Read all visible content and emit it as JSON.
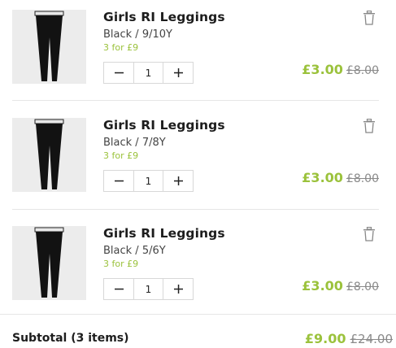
{
  "cart": {
    "items": [
      {
        "name": "Girls RI Leggings",
        "variant": "Black / 9/10Y",
        "promo": "3 for £9",
        "quantity": "1",
        "price_now": "£3.00",
        "price_was": "£8.00",
        "image_icon": "leggings-image"
      },
      {
        "name": "Girls RI Leggings",
        "variant": "Black / 7/8Y",
        "promo": "3 for £9",
        "quantity": "1",
        "price_now": "£3.00",
        "price_was": "£8.00",
        "image_icon": "leggings-image"
      },
      {
        "name": "Girls RI Leggings",
        "variant": "Black / 5/6Y",
        "promo": "3 for £9",
        "quantity": "1",
        "price_now": "£3.00",
        "price_was": "£8.00",
        "image_icon": "leggings-image"
      }
    ],
    "subtotal": {
      "label": "Subtotal (3 items)",
      "price_now": "£9.00",
      "price_was": "£24.00"
    }
  },
  "icons": {
    "decrease": "minus-icon",
    "increase": "plus-icon",
    "remove": "trash-icon"
  },
  "colors": {
    "sale_price": "#9bc23c",
    "promo": "#9bc23c",
    "was_price": "#8a8a8a",
    "divider": "#e6e6e6"
  }
}
